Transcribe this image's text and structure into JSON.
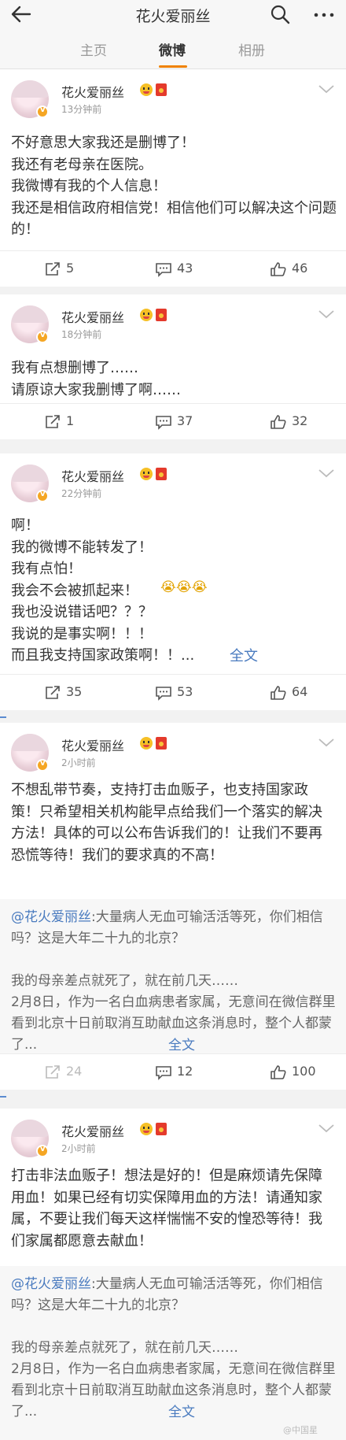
{
  "header": {
    "title": "花火爱丽丝"
  },
  "tabs": [
    {
      "label": "主页"
    },
    {
      "label": "微博"
    },
    {
      "label": "相册"
    }
  ],
  "icons": {
    "back": "arrow-left-icon",
    "search": "search-icon",
    "more": "more-dots-icon",
    "repost": "repost-icon",
    "comment": "comment-icon",
    "like": "like-icon",
    "verified": "verified-badge-icon",
    "menu": "chevron-down-icon"
  },
  "colors": {
    "accent": "#f08200",
    "link": "#4a7bbf"
  },
  "posts": [
    {
      "user": "花火爱丽丝",
      "time": "13分钟前",
      "text": "不好意思大家我还是删博了！\n我还有老母亲在医院。\n我微博有我的个人信息！\n我还是相信政府相信党！相信他们可以解决这个问题的！",
      "reposts": "5",
      "comments": "43",
      "likes": "46"
    },
    {
      "user": "花火爱丽丝",
      "time": "18分钟前",
      "text": "我有点想删博了……\n请原谅大家我删博了啊……",
      "reposts": "1",
      "comments": "37",
      "likes": "32"
    },
    {
      "user": "花火爱丽丝",
      "time": "22分钟前",
      "text": "啊！\n我的微博不能转发了！\n我有点怕！\n我会不会被抓起来！\n我也没说错话吧？？？\n我说的是事实啊！！！\n而且我支持国家政策啊！！...",
      "emojis": "😭😭😭",
      "full_text_link": "全文",
      "reposts": "35",
      "comments": "53",
      "likes": "64"
    },
    {
      "user": "花火爱丽丝",
      "time": "2小时前",
      "text": "不想乱带节奏，支持打击血贩子，也支持国家政策！只希望相关机构能早点给我们一个落实的解决方法！具体的可以公布告诉我们的！让我们不要再恐慌等待！我们的要求真的不高！",
      "repost_mention": "@花火爱丽丝",
      "repost_text": ":大量病人无血可输活活等死，你们相信吗？这是大年二十九的北京？\n\n我的母亲差点就死了，就在前几天……\n2月8日，作为一名白血病患者家属，无意间在微信群里看到北京十日前取消互助献血这条消息时，整个人都蒙了...",
      "full_text_link": "全文",
      "reposts": "24",
      "comments": "12",
      "likes": "100"
    },
    {
      "user": "花火爱丽丝",
      "time": "2小时前",
      "text": "打击非法血贩子！想法是好的！但是麻烦请先保障用血！如果已经有切实保障用血的方法！请通知家属，不要让我们每天这样惴惴不安的惶恐等待！我们家属都愿意去献血！",
      "repost_mention": "@花火爱丽丝",
      "repost_text": ":大量病人无血可输活活等死，你们相信吗？这是大年二十九的北京？\n\n我的母亲差点就死了，就在前几天……\n2月8日，作为一名白血病患者家属，无意间在微信群里看到北京十日前取消互助献血这条消息时，整个人都蒙了...",
      "full_text_link": "全文"
    }
  ],
  "watermark": "@中国星"
}
